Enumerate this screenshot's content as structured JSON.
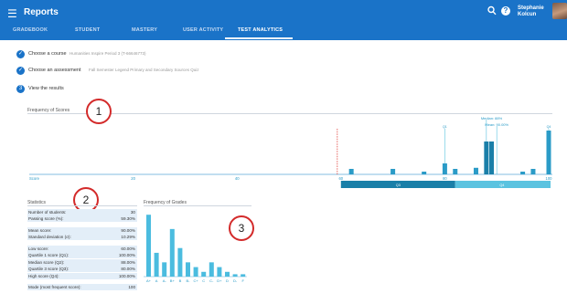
{
  "header": {
    "title": "Reports",
    "user_name": "Stephanie Kolcun",
    "help_glyph": "?",
    "tabs": [
      {
        "label": "GRADEBOOK"
      },
      {
        "label": "STUDENT"
      },
      {
        "label": "MASTERY"
      },
      {
        "label": "USER ACTIVITY"
      },
      {
        "label": "TEST ANALYTICS"
      }
    ],
    "active_tab": "TEST ANALYTICS"
  },
  "steps": [
    {
      "label": "Choose a course",
      "detail": "Humanities Inspire Period 3 (T-66646773)",
      "marker": "✓"
    },
    {
      "label": "Choose an assessment",
      "detail": "Fall Semester Legend Primary and Secondary Sources Quiz",
      "marker": "✓"
    },
    {
      "label": "View the results",
      "detail": "",
      "marker": "3"
    }
  ],
  "callouts": [
    "1",
    "2",
    "3"
  ],
  "frequency_of_scores": {
    "title": "Frequency of Scores",
    "x_axis_label": "Score",
    "x_ticks": [
      "20",
      "40",
      "60",
      "80",
      "100"
    ],
    "annotations": [
      "Median: 88%",
      "Mean: 90.00%"
    ],
    "marker_labels": [
      "Q1",
      "Q4"
    ],
    "quartile_bar_labels": [
      "Q3",
      "Q4"
    ],
    "colors": {
      "bar": "#2a9bc7",
      "highlight": "#1a7fa8",
      "band_dark": "#1a7fa8",
      "band_light": "#5bc3e0",
      "low_line": "#e0403a",
      "marker_line": "#5bc3e0"
    }
  },
  "statistics": {
    "title": "Statistics",
    "rows": [
      {
        "k": "Number of students:",
        "v": "30"
      },
      {
        "k": "Passing score (%):",
        "v": "59.30%"
      },
      {
        "k": "",
        "v": ""
      },
      {
        "k": "Mean score:",
        "v": "90.00%"
      },
      {
        "k": "Standard deviation (σ):",
        "v": "10.29%"
      },
      {
        "k": "",
        "v": ""
      },
      {
        "k": "Low score:",
        "v": "60.00%"
      },
      {
        "k": "Quartile 1 score (Q1):",
        "v": "100.00%"
      },
      {
        "k": "Median score (Q2):",
        "v": "88.00%"
      },
      {
        "k": "Quartile 3 score (Q3):",
        "v": "80.00%"
      },
      {
        "k": "High score (Q4):",
        "v": "100.00%"
      },
      {
        "k": "",
        "v": ""
      },
      {
        "k": "Mode (most frequent score):",
        "v": "100"
      }
    ]
  },
  "chart_data": [
    {
      "type": "bar",
      "title": "Frequency of Scores",
      "xlabel": "Score",
      "ylabel": "",
      "xlim": [
        0,
        100
      ],
      "ylim": [
        0,
        10
      ],
      "x": [
        62,
        70,
        76,
        80,
        82,
        86,
        88,
        89,
        95,
        97,
        100
      ],
      "values": [
        1,
        1,
        0.5,
        2,
        1,
        1.2,
        6,
        6,
        0.5,
        1,
        8
      ],
      "annotations": [
        "Median: 88%",
        "Mean: 90.00%"
      ]
    },
    {
      "type": "bar",
      "title": "Frequency of Grades",
      "categories": [
        "A+",
        "A",
        "A-",
        "B+",
        "B",
        "B-",
        "C+",
        "C",
        "C-",
        "D+",
        "D",
        "D-",
        "F"
      ],
      "values": [
        13,
        5,
        3,
        10,
        6,
        3,
        2,
        1,
        3,
        2,
        1,
        0.5,
        0.5
      ],
      "ylim": [
        0,
        14
      ]
    }
  ]
}
